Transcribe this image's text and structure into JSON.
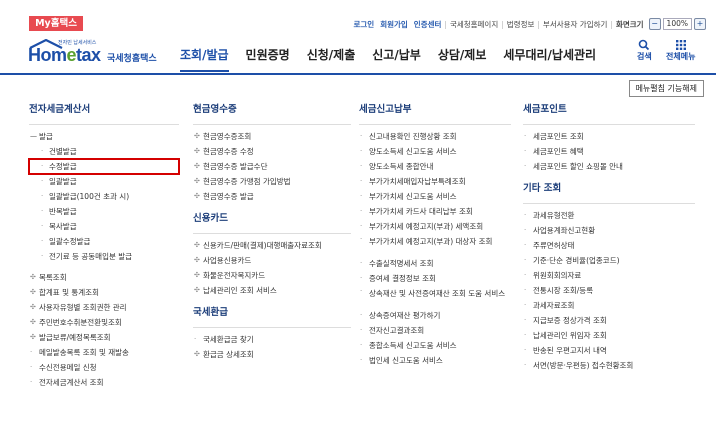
{
  "header": {
    "my_hometax": "My홈택스",
    "links": [
      {
        "label": "로그인",
        "style": "blue"
      },
      {
        "label": "회원가입",
        "style": "blue"
      },
      {
        "label": "인증센터",
        "style": "blue"
      },
      {
        "label": "국세청홈페이지",
        "style": "normal"
      },
      {
        "label": "법령정보",
        "style": "normal"
      },
      {
        "label": "부서사용자 가입하기",
        "style": "normal"
      },
      {
        "label": "화면크기",
        "style": "normal"
      }
    ],
    "zoom_minus": "−",
    "zoom_value": "100%",
    "zoom_plus": "+"
  },
  "nav": {
    "logo_tiny": "전자민 납세서비스",
    "logo_main": "Hom",
    "logo_e": "e",
    "logo_tail": "tax",
    "logo_agency": "국세청홈택스",
    "menu": [
      "조회/발급",
      "민원증명",
      "신청/제출",
      "신고/납부",
      "상담/제보",
      "세무대리/납세관리"
    ],
    "active_index": 0,
    "search_label": "검색",
    "all_menu_label": "전체메뉴"
  },
  "menu_release_button": "메뉴펼침 기능해제",
  "columns": [
    {
      "sections": [
        {
          "title": "전자세금계산서",
          "items": [
            {
              "label": "발급",
              "type": "minus"
            },
            {
              "label": "건별발급",
              "type": "sub"
            },
            {
              "label": "수정발급",
              "type": "sub",
              "highlight": true
            },
            {
              "label": "일괄발급",
              "type": "sub"
            },
            {
              "label": "일괄발급(100건 초과 시)",
              "type": "sub"
            },
            {
              "label": "반복발급",
              "type": "sub"
            },
            {
              "label": "복사발급",
              "type": "sub"
            },
            {
              "label": "일괄수정발급",
              "type": "sub"
            },
            {
              "label": "전기료 등 공동매입분 발급",
              "type": "sub"
            },
            {
              "label": "목록조회",
              "type": "plus",
              "gap": true
            },
            {
              "label": "합계표 및 통계조회",
              "type": "plus"
            },
            {
              "label": "사용자유형별 조회권한 관리",
              "type": "plus"
            },
            {
              "label": "주민번호수취분전환및조회",
              "type": "plus"
            },
            {
              "label": "발급보류/예정목록조회",
              "type": "plus"
            },
            {
              "label": "메일발송목록 조회 및 재발송",
              "type": "dot"
            },
            {
              "label": "수신전용메일 신청",
              "type": "dot"
            },
            {
              "label": "전자세금계산서 조회",
              "type": "dot"
            }
          ]
        }
      ]
    },
    {
      "sections": [
        {
          "title": "현금영수증",
          "items": [
            {
              "label": "현금영수증조회",
              "type": "plus"
            },
            {
              "label": "현금영수증 수정",
              "type": "plus"
            },
            {
              "label": "현금영수증 발급수단",
              "type": "plus"
            },
            {
              "label": "현금영수증 가맹점 가입방법",
              "type": "plus"
            },
            {
              "label": "현금영수증 발급",
              "type": "plus"
            }
          ]
        },
        {
          "title": "신용카드",
          "items": [
            {
              "label": "신용카드/판매(결제)대행매출자료조회",
              "type": "plus"
            },
            {
              "label": "사업용신용카드",
              "type": "plus"
            },
            {
              "label": "화물운전자복지카드",
              "type": "plus"
            },
            {
              "label": "납세관리인 조회 서비스",
              "type": "plus"
            }
          ]
        },
        {
          "title": "국세환급",
          "items": [
            {
              "label": "국세환급금 찾기",
              "type": "dot"
            },
            {
              "label": "환급금 상세조회",
              "type": "plus"
            }
          ]
        }
      ]
    },
    {
      "sections": [
        {
          "title": "세금신고납부",
          "items": [
            {
              "label": "신고내용확인 진행상황 조회",
              "type": "dot"
            },
            {
              "label": "양도소득세 신고도움 서비스",
              "type": "dot"
            },
            {
              "label": "양도소득세 종합안내",
              "type": "dot"
            },
            {
              "label": "부가가치세매입자납부특례조회",
              "type": "dot"
            },
            {
              "label": "부가가치세 신고도움 서비스",
              "type": "dot"
            },
            {
              "label": "부가가치세 카드사 대리납부 조회",
              "type": "dot"
            },
            {
              "label": "부가가치세 예정고지(부과) 세액조회",
              "type": "dot"
            },
            {
              "label": "부가가치세 예정고지(부과) 대상자 조회",
              "type": "dot",
              "two": true
            },
            {
              "label": "수출실적명세서 조회",
              "type": "dot"
            },
            {
              "label": "증여세 결정정보 조회",
              "type": "dot"
            },
            {
              "label": "상속재산 및 사전증여재산 조회 도움 서비스",
              "type": "dot",
              "two": true
            },
            {
              "label": "상속증여재산 평가하기",
              "type": "dot"
            },
            {
              "label": "전자신고결과조회",
              "type": "dot"
            },
            {
              "label": "종합소득세 신고도움 서비스",
              "type": "dot"
            },
            {
              "label": "법인세 신고도움 서비스",
              "type": "dot"
            }
          ]
        }
      ]
    },
    {
      "sections": [
        {
          "title": "세금포인트",
          "items": [
            {
              "label": "세금포인트 조회",
              "type": "dot"
            },
            {
              "label": "세금포인트 혜택",
              "type": "dot"
            },
            {
              "label": "세금포인트 할인 쇼핑몰 안내",
              "type": "dot"
            }
          ]
        },
        {
          "title": "기타 조회",
          "items": [
            {
              "label": "과세유형전환",
              "type": "dot"
            },
            {
              "label": "사업용계좌신고현황",
              "type": "dot"
            },
            {
              "label": "주류면허상태",
              "type": "dot"
            },
            {
              "label": "기준·단순 경비율(업종코드)",
              "type": "dot"
            },
            {
              "label": "위원회회의자료",
              "type": "dot"
            },
            {
              "label": "전통시장 조회/등록",
              "type": "dot"
            },
            {
              "label": "과세자료조회",
              "type": "dot"
            },
            {
              "label": "지급보증 정상가격 조회",
              "type": "dot"
            },
            {
              "label": "납세관리인 위임자 조회",
              "type": "dot"
            },
            {
              "label": "반송된 우편고지서 내역",
              "type": "dot"
            },
            {
              "label": "서면(방문·우편등) 접수현황조회",
              "type": "dot"
            }
          ]
        }
      ]
    }
  ],
  "colors": {
    "brand": "#1d4fa8",
    "my_hometax_bg": "#e84a50",
    "highlight": "#d40000",
    "logo_e": "#5aa12f"
  },
  "icons": {
    "search": "search-icon",
    "all_menu": "grid-icon"
  }
}
